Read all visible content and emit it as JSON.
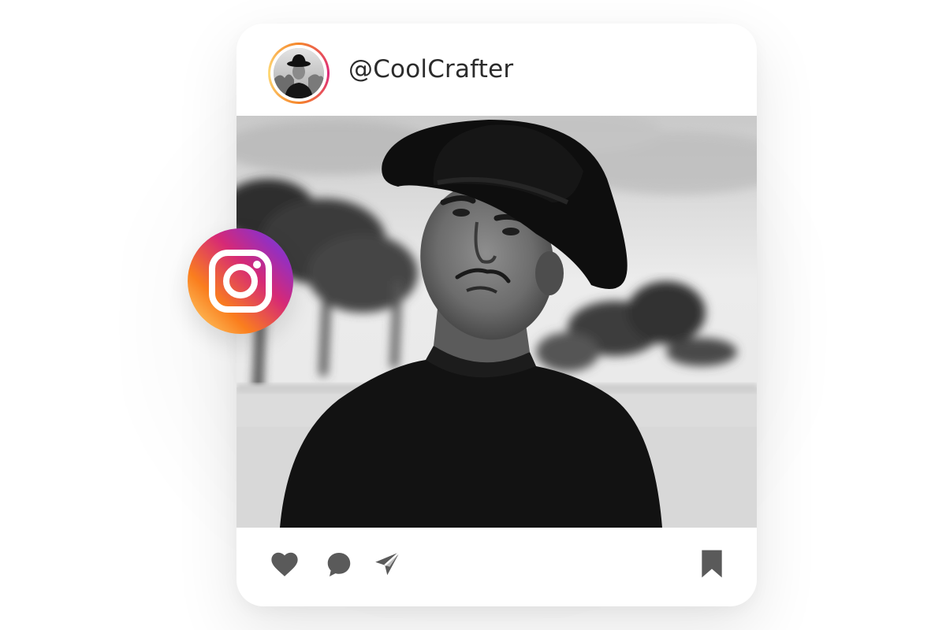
{
  "post": {
    "username": "@CoolCrafter"
  },
  "icons": {
    "badge": "instagram-icon",
    "like": "heart-icon",
    "comment": "comment-icon",
    "share": "send-icon",
    "save": "bookmark-icon"
  },
  "colors": {
    "icon": "#5a5a5a",
    "username_text": "#2b2b2b",
    "card_background": "#ffffff"
  }
}
